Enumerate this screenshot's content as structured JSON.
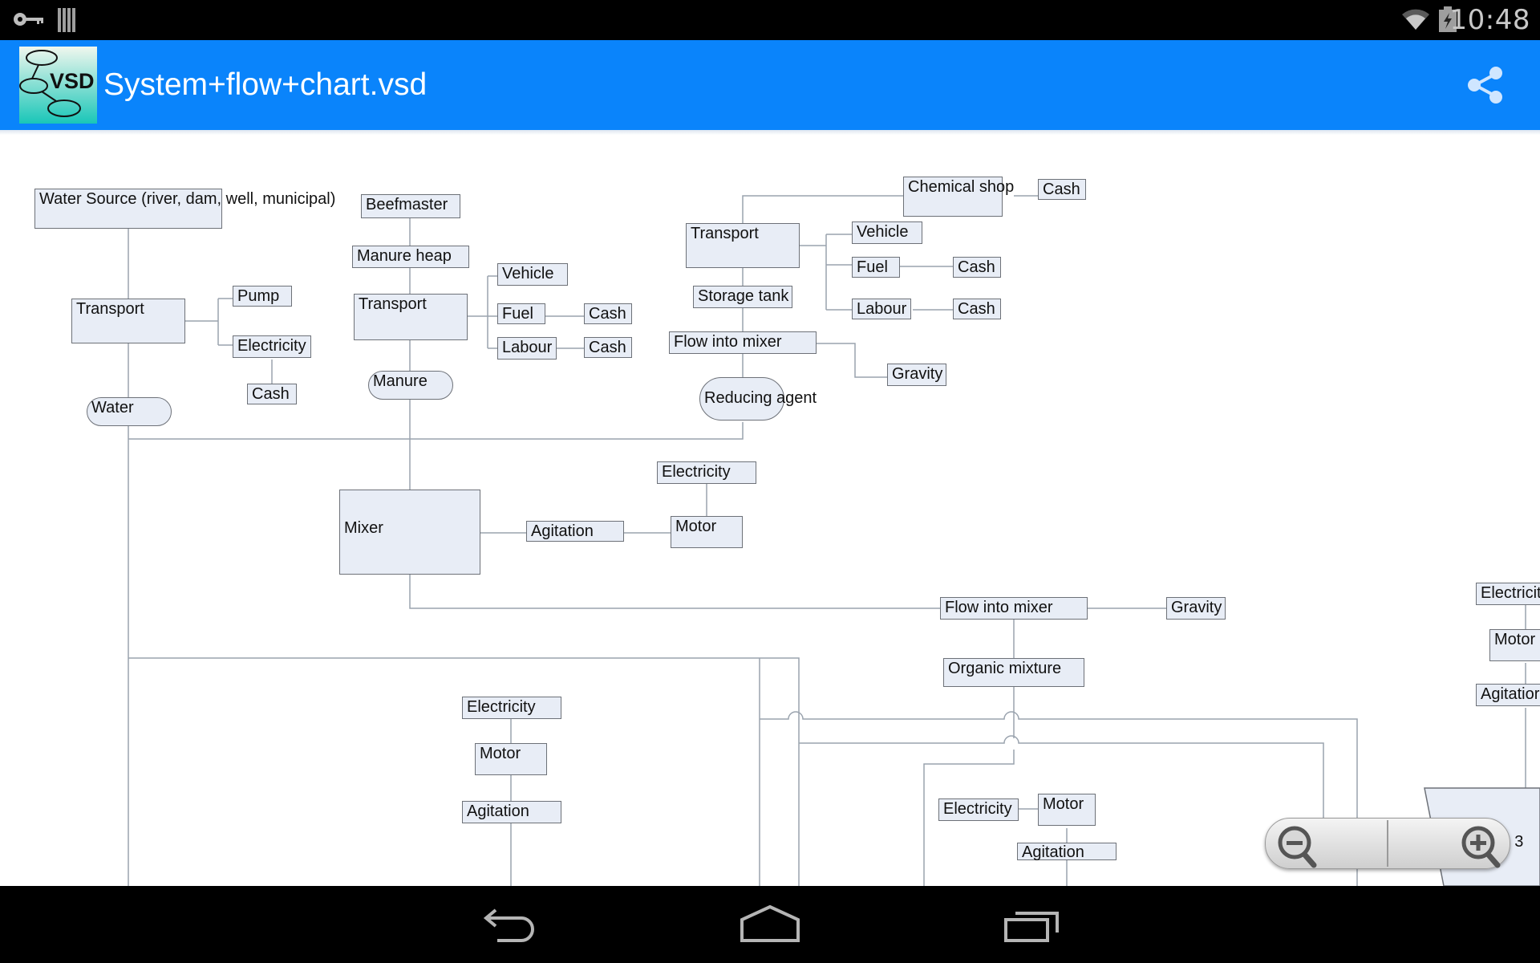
{
  "status_bar": {
    "time": "10:48",
    "left_icons": [
      "vpn-key-icon",
      "barcode-icon"
    ],
    "right_icons": [
      "wifi-icon",
      "battery-charging-icon"
    ]
  },
  "app_bar": {
    "app_icon": "vsd-viewer-logo",
    "logo_text": "VSD",
    "title": "System+flow+chart.vsd",
    "actions": [
      "share-icon"
    ]
  },
  "diagram": {
    "nodes": [
      {
        "id": "water-source",
        "label": "Water Source (river, dam, well, municipal)"
      },
      {
        "id": "transport-1",
        "label": "Transport"
      },
      {
        "id": "pump",
        "label": "Pump"
      },
      {
        "id": "electricity-1",
        "label": "Electricity"
      },
      {
        "id": "cash-1",
        "label": "Cash"
      },
      {
        "id": "water",
        "label": "Water"
      },
      {
        "id": "beefmaster",
        "label": "Beefmaster"
      },
      {
        "id": "manure-heap",
        "label": "Manure heap"
      },
      {
        "id": "transport-2",
        "label": "Transport"
      },
      {
        "id": "vehicle-1",
        "label": "Vehicle"
      },
      {
        "id": "fuel-1",
        "label": "Fuel"
      },
      {
        "id": "cash-2",
        "label": "Cash"
      },
      {
        "id": "labour-1",
        "label": "Labour"
      },
      {
        "id": "cash-3",
        "label": "Cash"
      },
      {
        "id": "manure",
        "label": "Manure"
      },
      {
        "id": "chemical-shop",
        "label": "Chemical shop"
      },
      {
        "id": "cash-4",
        "label": "Cash"
      },
      {
        "id": "transport-3",
        "label": "Transport"
      },
      {
        "id": "vehicle-2",
        "label": "Vehicle"
      },
      {
        "id": "fuel-2",
        "label": "Fuel"
      },
      {
        "id": "cash-5",
        "label": "Cash"
      },
      {
        "id": "labour-2",
        "label": "Labour"
      },
      {
        "id": "cash-6",
        "label": "Cash"
      },
      {
        "id": "storage-tank",
        "label": "Storage tank"
      },
      {
        "id": "flow-into-mixer-1",
        "label": "Flow into mixer"
      },
      {
        "id": "gravity-1",
        "label": "Gravity"
      },
      {
        "id": "reducing-agent",
        "label": "Reducing agent"
      },
      {
        "id": "mixer",
        "label": "Mixer"
      },
      {
        "id": "agitation-1",
        "label": "Agitation"
      },
      {
        "id": "motor-1",
        "label": "Motor"
      },
      {
        "id": "electricity-2",
        "label": "Electricity"
      },
      {
        "id": "flow-into-mixer-2",
        "label": "Flow into mixer"
      },
      {
        "id": "gravity-2",
        "label": "Gravity"
      },
      {
        "id": "organic-mixture",
        "label": "Organic mixture"
      },
      {
        "id": "electricity-3",
        "label": "Electricity"
      },
      {
        "id": "motor-2",
        "label": "Motor"
      },
      {
        "id": "agitation-2",
        "label": "Agitation"
      },
      {
        "id": "electricity-4",
        "label": "Electricity"
      },
      {
        "id": "motor-3",
        "label": "Motor"
      },
      {
        "id": "agitation-3",
        "label": "Agitation"
      },
      {
        "id": "electricity-5",
        "label": "Electricit"
      },
      {
        "id": "motor-4",
        "label": "Motor"
      },
      {
        "id": "agitation-4",
        "label": "Agitatior"
      },
      {
        "id": "digester-3",
        "label": "r 3"
      }
    ]
  },
  "zoom_controls": {
    "zoom_out": "zoom-out-icon",
    "zoom_in": "zoom-in-icon"
  },
  "nav_bar": {
    "buttons": [
      "back-icon",
      "home-icon",
      "recent-apps-icon"
    ]
  }
}
